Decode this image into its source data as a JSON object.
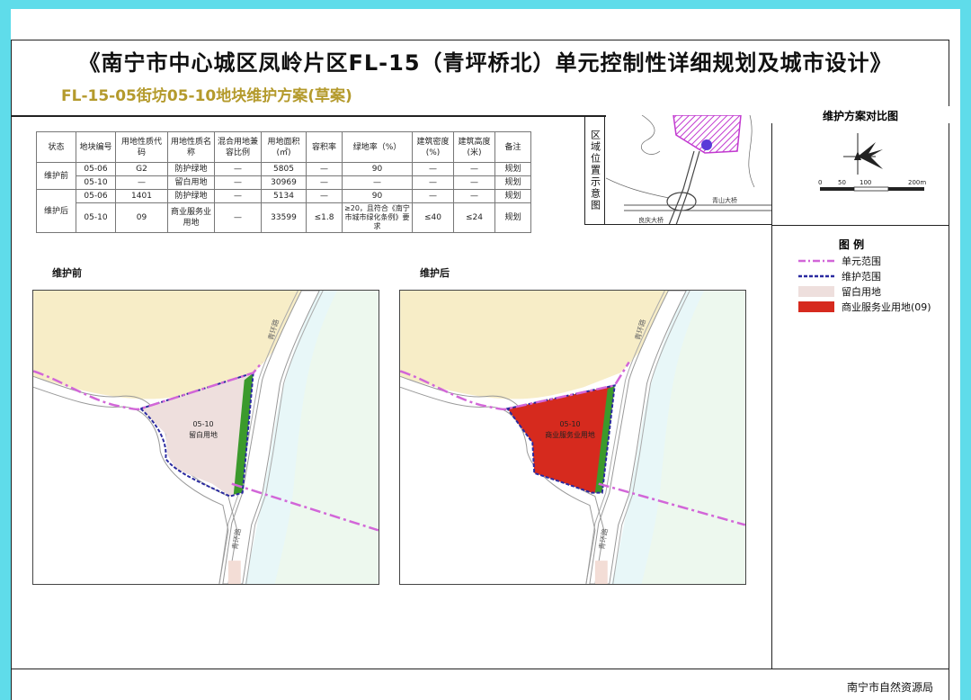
{
  "header": {
    "title": "《南宁市中心城区凤岭片区FL-15（青坪桥北）单元控制性详细规划及城市设计》",
    "subtitle": "FL-15-05街坊05-10地块维护方案(草案)"
  },
  "table": {
    "headers": [
      "状态",
      "地块编号",
      "用地性质代码",
      "用地性质名称",
      "混合用地兼容比例",
      "用地面积(㎡)",
      "容积率",
      "绿地率（%）",
      "建筑密度(%)",
      "建筑高度(米)",
      "备注"
    ],
    "before_label": "维护前",
    "after_label": "维护后",
    "before_rows": [
      [
        "05-06",
        "G2",
        "防护绿地",
        "—",
        "5805",
        "—",
        "90",
        "—",
        "—",
        "规划"
      ],
      [
        "05-10",
        "—",
        "留白用地",
        "—",
        "30969",
        "—",
        "—",
        "—",
        "—",
        "规划"
      ]
    ],
    "after_rows": [
      [
        "05-06",
        "1401",
        "防护绿地",
        "—",
        "5134",
        "—",
        "90",
        "—",
        "—",
        "规划"
      ],
      [
        "05-10",
        "09",
        "商业服务业用地",
        "—",
        "33599",
        "≤1.8",
        "≥20，且符合《南宁市城市绿化条例》要求",
        "≤40",
        "≤24",
        "规划"
      ]
    ]
  },
  "location_map": {
    "label": "区域位置示意图",
    "road_labels": [
      "良庆大桥",
      "青山大桥"
    ]
  },
  "compare_title": "维护方案对比图",
  "scale": {
    "ticks": [
      "0",
      "50",
      "100",
      "200m"
    ]
  },
  "legend": {
    "title": "图 例",
    "items": [
      {
        "label": "单元范围",
        "color": "#d266d8"
      },
      {
        "label": "维护范围",
        "color": "#2a2aa0"
      },
      {
        "label": "留白用地",
        "color": "#eedfdd"
      },
      {
        "label": "商业服务业用地(09)",
        "color": "#d62a1e"
      }
    ]
  },
  "before_panel": {
    "title": "维护前",
    "parcel_code": "05-10",
    "parcel_name": "留白用地",
    "road_top": "青环路",
    "road_bottom": "青环路"
  },
  "after_panel": {
    "title": "维护后",
    "parcel_code": "05-10",
    "parcel_name": "商业服务业用地",
    "road_top": "青环路",
    "road_bottom": "青环路"
  },
  "footer": "南宁市自然资源局"
}
